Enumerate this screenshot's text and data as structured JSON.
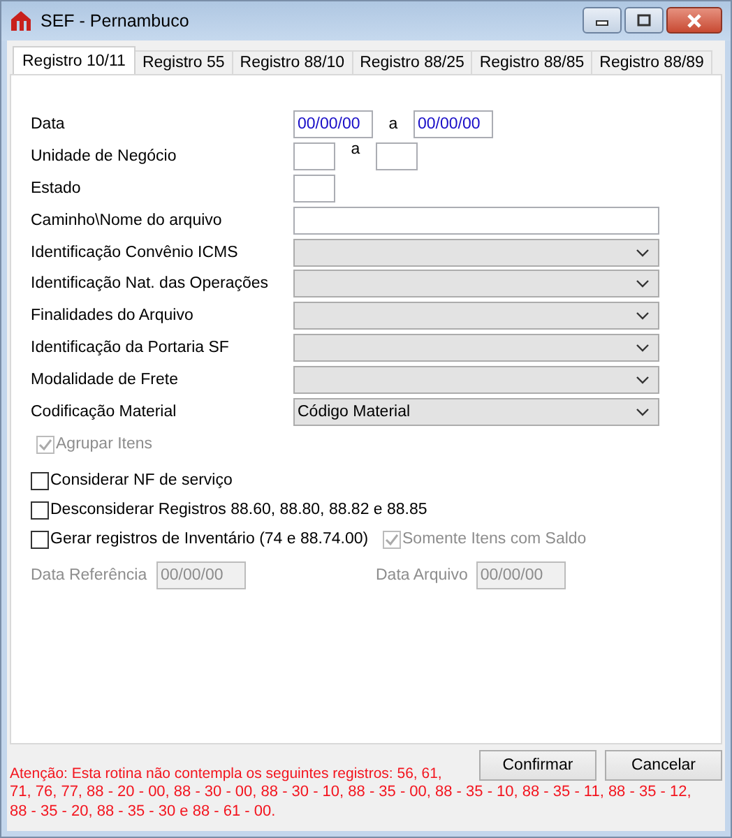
{
  "window": {
    "title": "SEF - Pernambuco"
  },
  "tabs": [
    {
      "label": "Registro 10/11",
      "selected": true
    },
    {
      "label": "Registro 55",
      "selected": false
    },
    {
      "label": "Registro 88/10",
      "selected": false
    },
    {
      "label": "Registro 88/25",
      "selected": false
    },
    {
      "label": "Registro 88/85",
      "selected": false
    },
    {
      "label": "Registro 88/89",
      "selected": false
    }
  ],
  "fields": [
    {
      "kind": "range",
      "label": "Data",
      "from": "00/00/00",
      "separator": "a",
      "to": "00/00/00"
    },
    {
      "kind": "range",
      "label": "Unidade de Negócio",
      "separator": "a"
    },
    {
      "kind": "short",
      "label": "Estado"
    },
    {
      "kind": "text",
      "label": "Caminho\\Nome do arquivo"
    },
    {
      "kind": "combo",
      "label": "Identificação Convênio ICMS"
    },
    {
      "kind": "combo",
      "label": "Identificação Nat. das Operações"
    },
    {
      "kind": "combo",
      "label": "Finalidades do Arquivo"
    },
    {
      "kind": "combo",
      "label": "Identificação da Portaria SF"
    },
    {
      "kind": "combo",
      "label": "Modalidade de Frete"
    },
    {
      "kind": "combo",
      "label": "Codificação Material",
      "value": "Código Material"
    }
  ],
  "group_option": {
    "label": "Agrupar Itens",
    "checked": true,
    "disabled": true
  },
  "options": [
    {
      "label": "Considerar NF de serviço",
      "checked": false,
      "disabled": false
    },
    {
      "label": "Desconsiderar Registros 88.60, 88.80, 88.82 e 88.85",
      "checked": false,
      "disabled": false
    }
  ],
  "inventory": {
    "label": "Gerar registros de Inventário (74 e 88.74.00)",
    "checked": false,
    "disabled": false,
    "balance_option": {
      "label": "Somente Itens com Saldo",
      "checked": true,
      "disabled": true
    }
  },
  "dates": [
    {
      "label": "Data Referência",
      "value": "00/00/00",
      "disabled": true
    },
    {
      "label": "Data Arquivo",
      "value": "00/00/00",
      "disabled": true
    }
  ],
  "buttons": [
    "Confirmar",
    "Cancelar"
  ],
  "notice": [
    "Atenção: Esta rotina não contempla os seguintes registros: 56, 61,",
    "71, 76, 77, 88 - 20 - 00, 88 - 30 - 00, 88 - 30 - 10, 88 - 35 - 00, 88 - 35 - 10, 88 - 35 - 11, 88 - 35 - 12, 88 - 35 - 20, 88 - 35 - 30 e 88 - 61 - 00."
  ]
}
